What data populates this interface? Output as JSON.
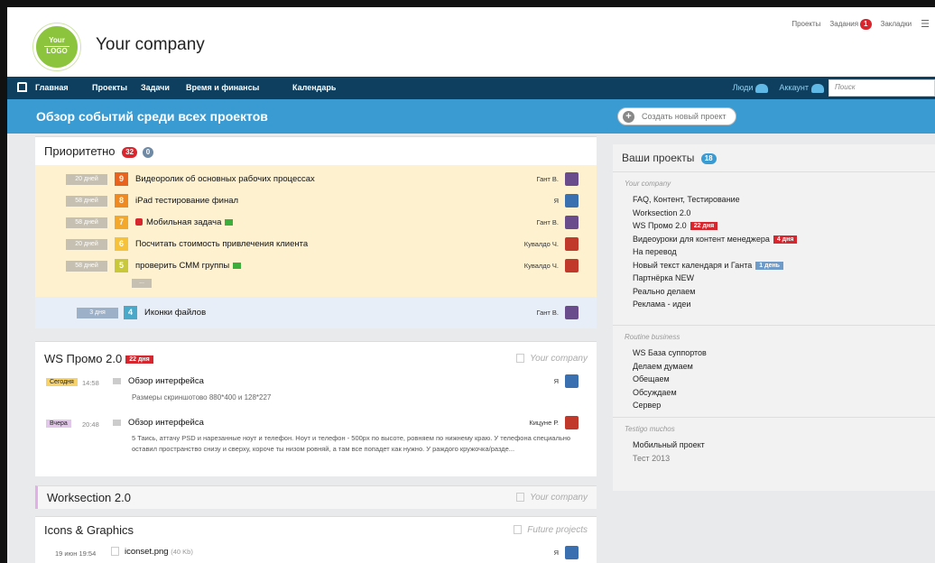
{
  "header": {
    "logo_line1": "Your",
    "logo_line2": "LOGO",
    "company": "Your company",
    "toplinks": {
      "projects": "Проекты",
      "tasks": "Задания",
      "tasks_count": "1",
      "bookmarks": "Закладки"
    }
  },
  "nav": {
    "items": [
      "Главная",
      "Проекты",
      "Задачи",
      "Время и финансы",
      "Календарь"
    ],
    "people": "Люди",
    "account": "Аккаунт",
    "search_placeholder": "Поиск"
  },
  "band": {
    "title": "Обзор событий среди всех проектов",
    "new_project": "Создать новый проект"
  },
  "priority": {
    "title": "Приоритетно",
    "count_red": "32",
    "count_gray": "0",
    "more": "...",
    "tasks": [
      {
        "dur": "20 дней",
        "num": "9",
        "num_color": "#e8641e",
        "title": "Видеоролик об основных рабочих процессах",
        "assignee": "Гант В.",
        "avatar_color": "#6a4c8c",
        "flag": false,
        "lock": false
      },
      {
        "dur": "58 дней",
        "num": "8",
        "num_color": "#ef8a22",
        "title": "iPad тестирование финал",
        "assignee": "Я",
        "avatar_color": "#3a6fb0",
        "flag": false,
        "lock": false
      },
      {
        "dur": "58 дней",
        "num": "7",
        "num_color": "#f3a82b",
        "title": "Мобильная задача",
        "assignee": "Гант В.",
        "avatar_color": "#6a4c8c",
        "flag": true,
        "lock": true
      },
      {
        "dur": "20 дней",
        "num": "6",
        "num_color": "#f5c23a",
        "title": "Посчитать стоимость привлечения клиента",
        "assignee": "Кувалдо Ч.",
        "avatar_color": "#c0392b",
        "flag": false,
        "lock": false
      },
      {
        "dur": "58 дней",
        "num": "5",
        "num_color": "#c8c83a",
        "title": "проверить СММ группы",
        "assignee": "Кувалдо Ч.",
        "avatar_color": "#c0392b",
        "flag": true,
        "lock": false
      }
    ],
    "extra": {
      "dur": "3 дня",
      "num": "4",
      "num_color": "#4aa8c8",
      "title": "Иконки файлов",
      "assignee": "Гант В.",
      "avatar_color": "#6a4c8c"
    }
  },
  "ws_promo": {
    "title": "WS Промо 2.0",
    "days": "22 дня",
    "category": "Your company",
    "entries": [
      {
        "date": "Сегодня",
        "date_bg": "#f7d26b",
        "time": "14:58",
        "title": "Обзор интерфейса",
        "sub": "Размеры скриншотово 880*400 и 128*227",
        "author": "Я",
        "avatar_color": "#3a6fb0"
      },
      {
        "date": "Вчера",
        "date_bg": "#e2c7ea",
        "time": "20:48",
        "title": "Обзор интерфейса",
        "sub": "5 Таись, аттачу PSD и нарезанные ноут и телефон. Ноут и телефон - 500px по высоте, ровняем по нижнему краю. У телефона специально оставил пространство снизу и сверху, короче ты низом ровняй, а там все попадет как нужно. У раждого кружочка/разде...",
        "author": "Кицуне Р.",
        "avatar_color": "#c0392b"
      }
    ]
  },
  "worksection": {
    "title": "Worksection 2.0",
    "category": "Your company"
  },
  "icons_graphics": {
    "title": "Icons & Graphics",
    "category": "Future projects",
    "file": {
      "date": "19 июн",
      "time": "19:54",
      "name": "iconset.png",
      "size": "(40 Kb)",
      "author": "Я",
      "avatar_color": "#3a6fb0"
    }
  },
  "projects_panel": {
    "title": "Ваши проекты",
    "count": "18",
    "groups": [
      {
        "name": "Your company",
        "items": [
          {
            "label": "FAQ, Контент, Тестирование"
          },
          {
            "label": "Worksection 2.0"
          },
          {
            "label": "WS Промо 2.0",
            "pill": "22 дня",
            "pill_color": "red"
          },
          {
            "label": "Видеоуроки для контент менеджера",
            "pill": "4 дня",
            "pill_color": "red"
          },
          {
            "label": "На перевод"
          },
          {
            "label": "Новый текст календаря и Ганта",
            "pill": "1 день",
            "pill_color": "blue"
          },
          {
            "label": "Партнёрка NEW"
          },
          {
            "label": "Реально делаем"
          },
          {
            "label": "Реклама - идеи"
          }
        ]
      },
      {
        "name": "Routine business",
        "items": [
          {
            "label": "WS База суппортов"
          },
          {
            "label": "Делаем думаем"
          },
          {
            "label": "Обещаем"
          },
          {
            "label": "Обсуждаем"
          },
          {
            "label": "Сервер"
          }
        ]
      },
      {
        "name": "Testigo muchos",
        "items": [
          {
            "label": "Мобильный проект"
          },
          {
            "label": "Тест 2013",
            "muted": true
          }
        ]
      }
    ]
  }
}
